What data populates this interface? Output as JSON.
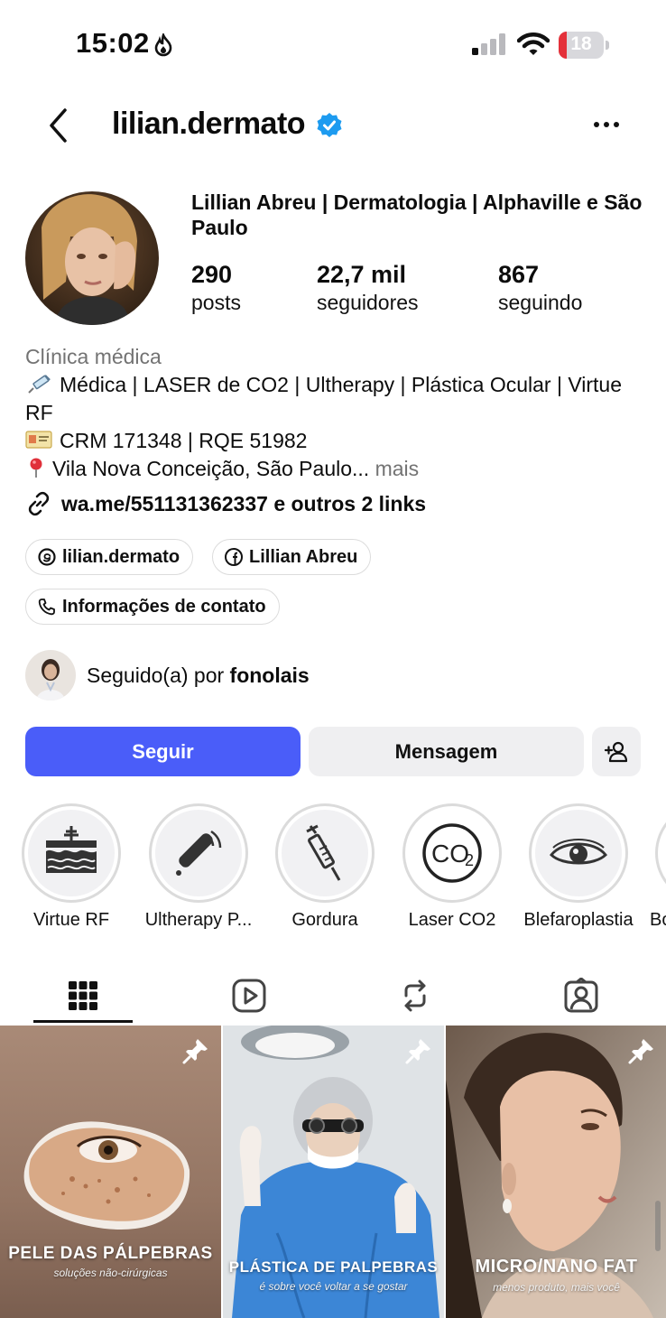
{
  "status_bar": {
    "time": "15:02",
    "battery_level": "18",
    "battery_fraction": 0.18,
    "colors": {
      "battery_low": "#e4313a"
    }
  },
  "header": {
    "username": "lilian.dermato",
    "verified": true,
    "colors": {
      "verified_badge": "#1d9bf0"
    }
  },
  "profile": {
    "display_name": "Lillian Abreu | Dermatologia | Alphaville e São Paulo",
    "stats": [
      {
        "value": "290",
        "label": "posts"
      },
      {
        "value": "22,7 mil",
        "label": "seguidores"
      },
      {
        "value": "867",
        "label": "seguindo"
      }
    ]
  },
  "bio": {
    "category": "Clínica médica",
    "line1": "Médica | LASER de CO2 | Ultherapy | Plástica Ocular | Virtue RF",
    "line2": "CRM 171348 | RQE 51982",
    "line3": "Vila Nova Conceição, São Paulo...",
    "more": "mais",
    "link": "wa.me/551131362337 e outros 2 links"
  },
  "chips": {
    "threads": "lilian.dermato",
    "facebook": "Lillian Abreu",
    "contact": "Informações de contato"
  },
  "followed_by": {
    "prefix": "Seguido(a) por",
    "name": "fonolais"
  },
  "actions": {
    "follow": "Seguir",
    "message": "Mensagem",
    "colors": {
      "follow_bg": "#4a5df9"
    }
  },
  "highlights": [
    {
      "label": "Virtue RF",
      "icon": "skin-layers-icon"
    },
    {
      "label": "Ultherapy P...",
      "icon": "ultrasound-device-icon"
    },
    {
      "label": "Gordura",
      "icon": "syringe-icon"
    },
    {
      "label": "Laser CO2",
      "icon": "co2-icon"
    },
    {
      "label": "Blefaroplastia",
      "icon": "eye-icon"
    },
    {
      "label": "Bo",
      "icon": "highlight-icon"
    }
  ],
  "tabs": [
    "grid-tab",
    "reels-tab",
    "reposts-tab",
    "tagged-tab"
  ],
  "posts": [
    {
      "title": "PELE DAS PÁLPEBRAS",
      "subtitle": "soluções não-cirúrgicas",
      "pinned": true
    },
    {
      "title": "PLÁSTICA DE PALPEBRAS",
      "subtitle": "é sobre você voltar a se gostar",
      "pinned": true
    },
    {
      "title": "MICRO/NANO FAT",
      "subtitle": "menos produto, mais você",
      "pinned": true
    }
  ]
}
